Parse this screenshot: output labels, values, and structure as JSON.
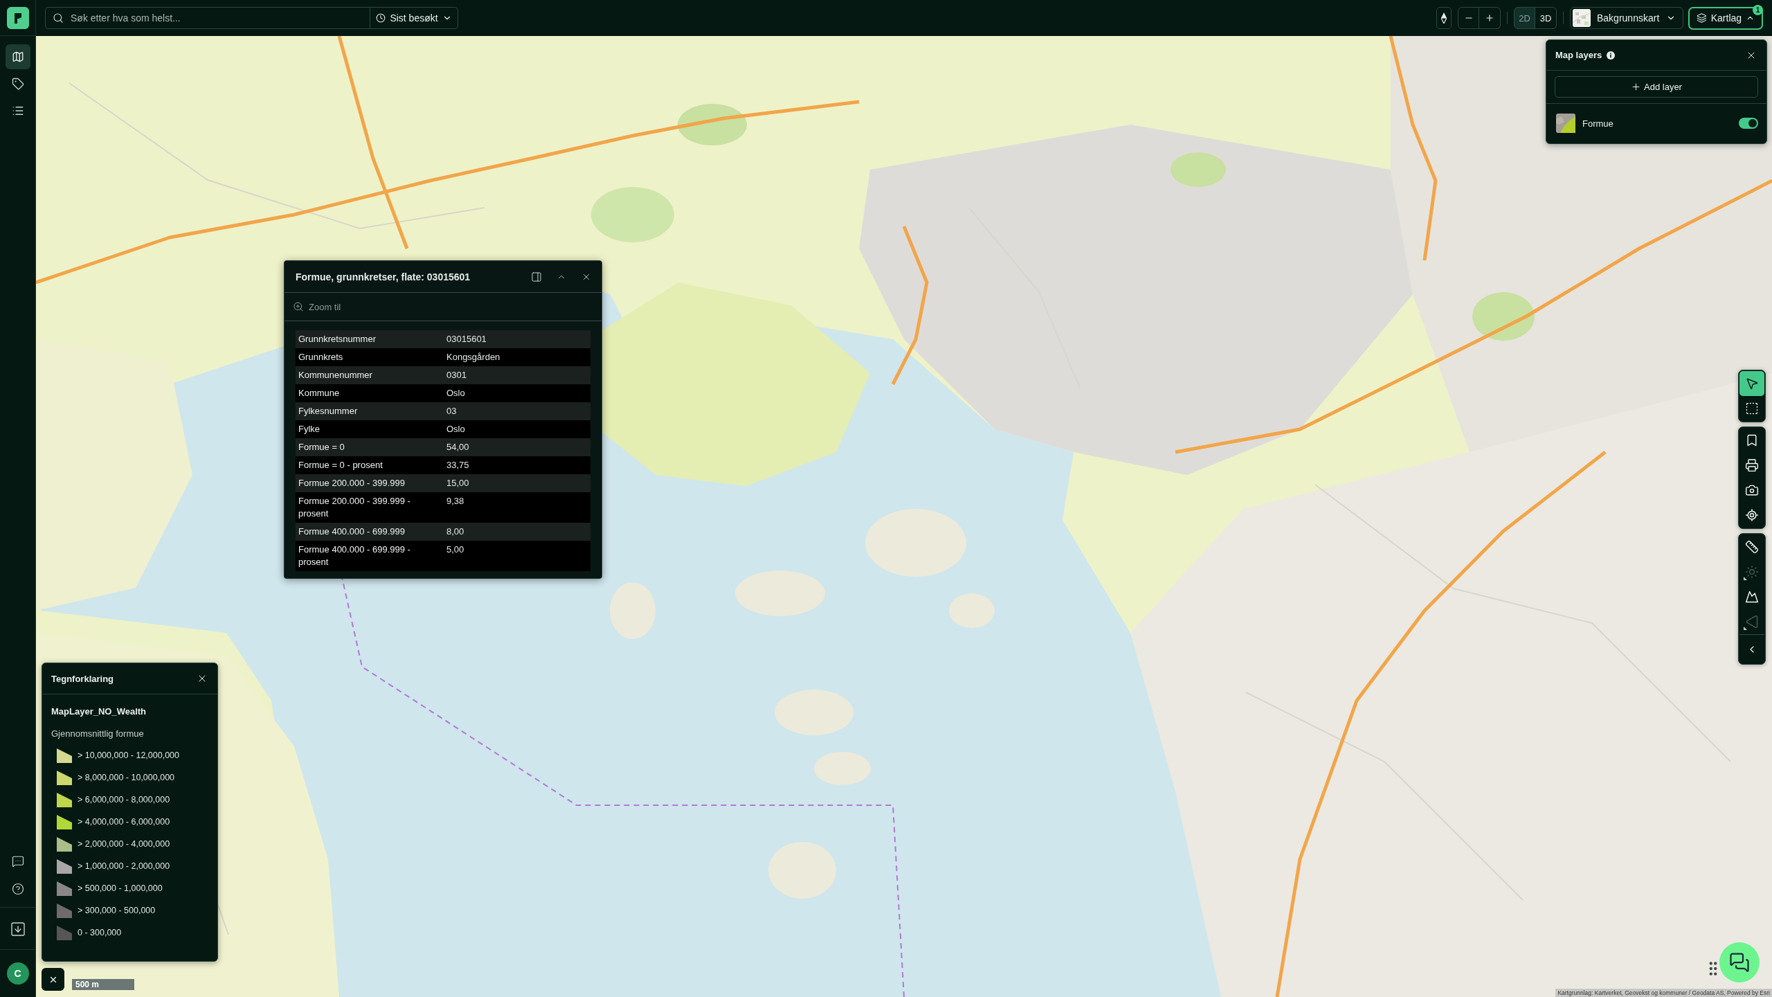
{
  "sidebar": {
    "items": [
      {
        "selected": true
      },
      {
        "selected": false
      },
      {
        "selected": false
      }
    ],
    "avatar": {
      "initial": "C"
    }
  },
  "search": {
    "placeholder": "Søk etter hva som helst...",
    "recent": "Sist besøkt"
  },
  "toolbar": {
    "view_modes": [
      {
        "label": "2D",
        "selected": true
      },
      {
        "label": "3D",
        "selected": false
      }
    ],
    "basemap": "Bakgrunnskart",
    "layers_button": {
      "label": "Kartlag",
      "expanded": true,
      "badge": "1"
    }
  },
  "layers_panel": {
    "title": "Map layers",
    "add_button": "Add layer",
    "layers": [
      {
        "name": "Formue",
        "on": true
      }
    ]
  },
  "popup": {
    "title": "Formue, grunnkretser, flate: 03015601",
    "zoom_action": "Zoom til",
    "rows": [
      {
        "field": "Grunnkretsnummer",
        "value": "03015601"
      },
      {
        "field": "Grunnkrets",
        "value": "Kongsgården"
      },
      {
        "field": "Kommunenummer",
        "value": "0301"
      },
      {
        "field": "Kommune",
        "value": "Oslo"
      },
      {
        "field": "Fylkesnummer",
        "value": "03"
      },
      {
        "field": "Fylke",
        "value": "Oslo"
      },
      {
        "field": "Formue = 0",
        "value": "54,00"
      },
      {
        "field": "Formue = 0 - prosent",
        "value": "33,75"
      },
      {
        "field": "Formue 200.000 - 399.999",
        "value": "15,00"
      },
      {
        "field": "Formue 200.000 - 399.999 - prosent",
        "value": "9,38"
      },
      {
        "field": "Formue 400.000 - 699.999",
        "value": "8,00"
      },
      {
        "field": "Formue 400.000 - 699.999 - prosent",
        "value": "5,00"
      }
    ]
  },
  "legend": {
    "title": "Tegnforklaring",
    "layer_name": "MapLayer_NO_Wealth",
    "subtitle": "Gjennomsnittlig formue",
    "classes": [
      {
        "label": "> 10,000,000 - 12,000,000",
        "color": "#d5d98f"
      },
      {
        "label": "> 8,000,000 - 10,000,000",
        "color": "#cbd86b"
      },
      {
        "label": "> 6,000,000 - 8,000,000",
        "color": "#c0d74a"
      },
      {
        "label": "> 4,000,000 - 6,000,000",
        "color": "#afd838"
      },
      {
        "label": "> 2,000,000 - 4,000,000",
        "color": "#abbe88"
      },
      {
        "label": "> 1,000,000 - 2,000,000",
        "color": "#a9a6a6"
      },
      {
        "label": "> 500,000 - 1,000,000",
        "color": "#8b8787"
      },
      {
        "label": "> 300,000 - 500,000",
        "color": "#6f6b6b"
      },
      {
        "label": "0 - 300,000",
        "color": "#575555"
      }
    ]
  },
  "scale_bar": "500 m",
  "map_tools": {
    "groups": [
      {
        "tools": [
          {
            "selected": true,
            "disabled": false,
            "submenu": false
          },
          {
            "selected": false,
            "disabled": false,
            "submenu": false
          }
        ]
      },
      {
        "tools": [
          {
            "selected": false,
            "disabled": false,
            "submenu": false
          },
          {
            "selected": false,
            "disabled": false,
            "submenu": false
          },
          {
            "selected": false,
            "disabled": false,
            "submenu": false
          },
          {
            "selected": false,
            "disabled": false,
            "submenu": false
          }
        ]
      },
      {
        "tools": [
          {
            "selected": false,
            "disabled": false,
            "submenu": false
          },
          {
            "selected": false,
            "disabled": true,
            "submenu": true
          },
          {
            "selected": false,
            "disabled": false,
            "submenu": false
          },
          {
            "selected": false,
            "disabled": true,
            "submenu": true
          }
        ]
      }
    ]
  },
  "attribution": "Kartgrunnlag: Kartverket, Geovekst og kommuner / Geodata AS, Powered by Esri"
}
